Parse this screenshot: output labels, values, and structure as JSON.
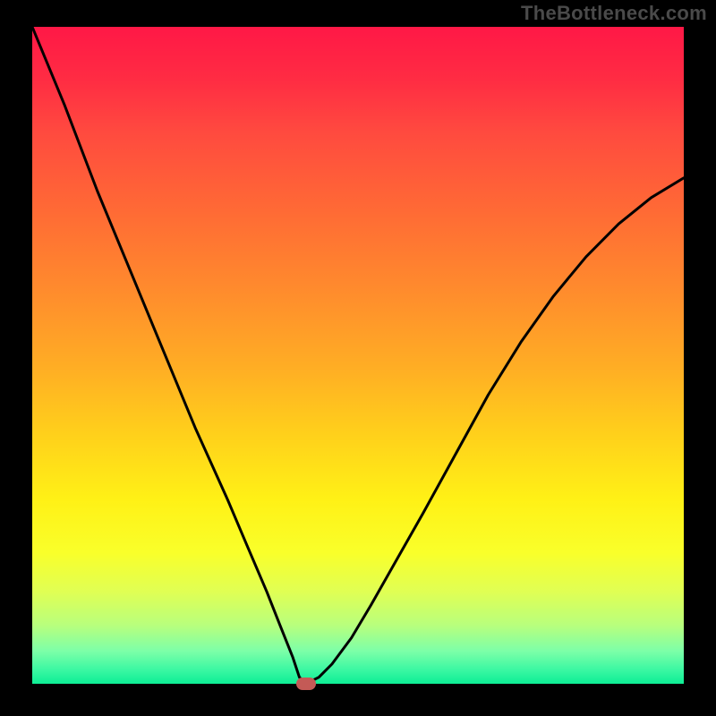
{
  "watermark": "TheBottleneck.com",
  "colors": {
    "background": "#000000",
    "watermark_text": "#4a4a4a",
    "curve": "#000000",
    "marker": "#c45a56",
    "gradient_stops": [
      "#ff1846",
      "#ff4a3f",
      "#ff8b2d",
      "#ffd01b",
      "#fff116",
      "#b9ff7c",
      "#0dee95"
    ]
  },
  "chart_data": {
    "type": "line",
    "title": "",
    "xlabel": "",
    "ylabel": "",
    "xlim": [
      0,
      100
    ],
    "ylim": [
      0,
      100
    ],
    "grid": false,
    "legend": false,
    "notes": "Single V-shaped curve; minimum ≈ (42, 0). No axis ticks or numeric labels are visible in the image — x/y values are relative percentages of the plot area.",
    "series": [
      {
        "name": "curve",
        "x": [
          0,
          5,
          10,
          15,
          20,
          25,
          30,
          33,
          36,
          38,
          40,
          41,
          42,
          44,
          46,
          49,
          52,
          56,
          60,
          65,
          70,
          75,
          80,
          85,
          90,
          95,
          100
        ],
        "y": [
          100,
          88,
          75,
          63,
          51,
          39,
          28,
          21,
          14,
          9,
          4,
          1,
          0,
          1,
          3,
          7,
          12,
          19,
          26,
          35,
          44,
          52,
          59,
          65,
          70,
          74,
          77
        ]
      }
    ],
    "marker": {
      "x": 42,
      "y": 0,
      "shape": "rounded-rect",
      "color": "#c45a56"
    }
  }
}
